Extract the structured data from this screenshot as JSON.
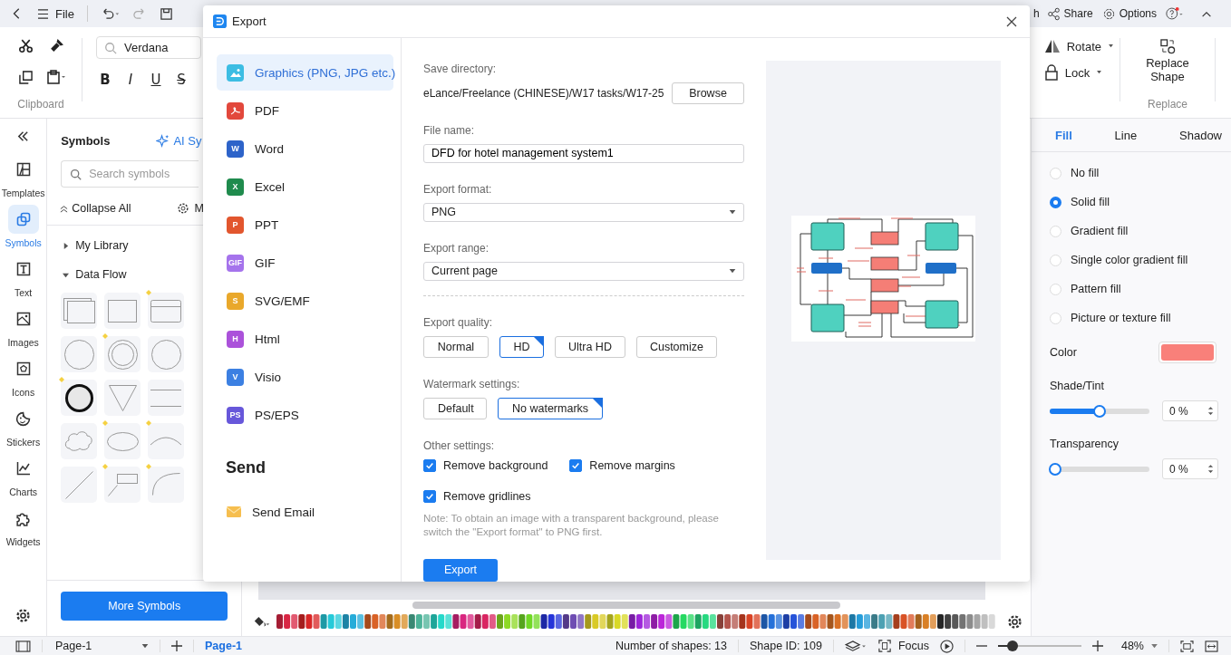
{
  "toolbar": {
    "file": "File",
    "font": "Verdana",
    "format_buttons": [
      "B",
      "I",
      "U",
      "S"
    ],
    "clipboard_label": "Clipboard",
    "search_cut": "h",
    "share": "Share",
    "options": "Options",
    "rotate": "Rotate",
    "lock": "Lock",
    "replace_shape": "Replace Shape",
    "replace_label": "Replace"
  },
  "left_rail": [
    {
      "label": "Templates",
      "selected": false
    },
    {
      "label": "Symbols",
      "selected": true
    },
    {
      "label": "Text",
      "selected": false
    },
    {
      "label": "Images",
      "selected": false
    },
    {
      "label": "Icons",
      "selected": false
    },
    {
      "label": "Stickers",
      "selected": false
    },
    {
      "label": "Charts",
      "selected": false
    },
    {
      "label": "Widgets",
      "selected": false
    }
  ],
  "symbols_panel": {
    "title": "Symbols",
    "ai_button": "AI Sy",
    "search": {
      "placeholder": "Search symbols"
    },
    "collapse": "Collapse All",
    "manage": "M",
    "groups": [
      {
        "label": "My Library",
        "expanded": false
      },
      {
        "label": "Data Flow",
        "expanded": true
      }
    ],
    "more_button": "More Symbols"
  },
  "export_dialog": {
    "title": "Export",
    "formats": [
      {
        "label": "Graphics (PNG, JPG etc.)",
        "selected": true,
        "kind": "image",
        "color": "#3cbde3"
      },
      {
        "label": "PDF",
        "selected": false,
        "kind": "pdf",
        "color": "#e2483c"
      },
      {
        "label": "Word",
        "selected": false,
        "kind": "letter",
        "icon_label": "W",
        "color": "#2d63c9"
      },
      {
        "label": "Excel",
        "selected": false,
        "kind": "letter",
        "icon_label": "X",
        "color": "#1f8b4d"
      },
      {
        "label": "PPT",
        "selected": false,
        "kind": "letter",
        "icon_label": "P",
        "color": "#e2562e"
      },
      {
        "label": "GIF",
        "selected": false,
        "kind": "letter",
        "icon_label": "GIF",
        "color": "#a573ec"
      },
      {
        "label": "SVG/EMF",
        "selected": false,
        "kind": "letter",
        "icon_label": "S",
        "color": "#e9a82b"
      },
      {
        "label": "Html",
        "selected": false,
        "kind": "letter",
        "icon_label": "H",
        "color": "#ab52da"
      },
      {
        "label": "Visio",
        "selected": false,
        "kind": "letter",
        "icon_label": "V",
        "color": "#3c80e2"
      },
      {
        "label": "PS/EPS",
        "selected": false,
        "kind": "letter",
        "icon_label": "PS",
        "color": "#6757da"
      }
    ],
    "send_heading": "Send",
    "send_items": [
      {
        "label": "Send Email"
      }
    ],
    "save_directory": {
      "label": "Save directory:",
      "value": "eLance/Freelance (CHINESE)/W17 tasks/W17-25",
      "button": "Browse"
    },
    "file_name": {
      "label": "File name:",
      "value": "DFD for hotel management system1"
    },
    "export_format": {
      "label": "Export format:",
      "value": "PNG"
    },
    "export_range": {
      "label": "Export range:",
      "value": "Current page"
    },
    "quality": {
      "label": "Export quality:",
      "options": [
        {
          "label": "Normal",
          "selected": false
        },
        {
          "label": "HD",
          "selected": true
        },
        {
          "label": "Ultra HD",
          "selected": false
        },
        {
          "label": "Customize",
          "selected": false
        }
      ]
    },
    "watermark": {
      "label": "Watermark settings:",
      "options": [
        {
          "label": "Default",
          "selected": false
        },
        {
          "label": "No watermarks",
          "selected": true
        }
      ]
    },
    "other": {
      "label": "Other settings:",
      "checkboxes": [
        {
          "label": "Remove background",
          "checked": true
        },
        {
          "label": "Remove margins",
          "checked": true
        },
        {
          "label": "Remove gridlines",
          "checked": true
        }
      ]
    },
    "note": "Note: To obtain an image with a transparent background, please switch the \"Export format\" to PNG first.",
    "export_button": "Export"
  },
  "right_panel": {
    "tabs": [
      {
        "label": "Fill",
        "selected": true
      },
      {
        "label": "Line",
        "selected": false
      },
      {
        "label": "Shadow",
        "selected": false
      }
    ],
    "fill_options": [
      {
        "label": "No fill",
        "selected": false
      },
      {
        "label": "Solid fill",
        "selected": true
      },
      {
        "label": "Gradient fill",
        "selected": false
      },
      {
        "label": "Single color gradient fill",
        "selected": false
      },
      {
        "label": "Pattern fill",
        "selected": false
      },
      {
        "label": "Picture or texture fill",
        "selected": false
      }
    ],
    "color_picker": {
      "label": "Color",
      "color": "#f9807a"
    },
    "shade": {
      "label": "Shade/Tint",
      "level": 0.5,
      "value": "0 %"
    },
    "transparency": {
      "label": "Transparency",
      "level": 0,
      "value": "0 %"
    }
  },
  "status_bar": {
    "page_selector": "Page-1",
    "page_tab": "Page-1",
    "shapes": "Number of shapes: 13",
    "shape_id": "Shape ID: 109",
    "focus": "Focus",
    "zoom": {
      "level": 0.12,
      "value": "48%"
    }
  }
}
